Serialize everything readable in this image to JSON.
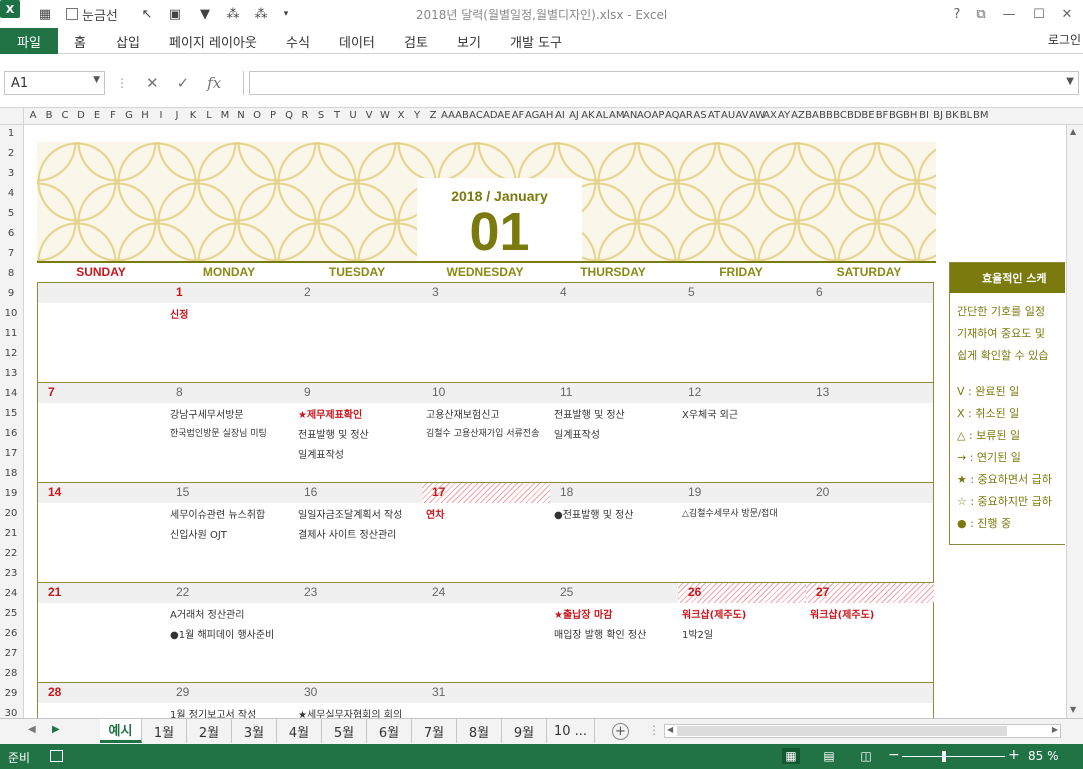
{
  "window": {
    "title": "2018년 달력(월별일정,월별디자인).xlsx - Excel",
    "gridlines_label": "눈금선",
    "help": "?",
    "signin": "로그인"
  },
  "ribbon": {
    "file_label": "파일",
    "tabs": [
      "홈",
      "삽입",
      "페이지 레이아웃",
      "수식",
      "데이터",
      "검토",
      "보기",
      "개발 도구"
    ]
  },
  "formula_bar": {
    "name_box": "A1",
    "fx_label": "fx",
    "formula_value": ""
  },
  "columns": [
    "A",
    "B",
    "C",
    "D",
    "E",
    "F",
    "G",
    "H",
    "I",
    "J",
    "K",
    "L",
    "M",
    "N",
    "O",
    "P",
    "Q",
    "R",
    "S",
    "T",
    "U",
    "V",
    "W",
    "X",
    "Y",
    "Z",
    "AA",
    "AB",
    "AC",
    "AD",
    "AE",
    "AF",
    "AG",
    "AH",
    "AI",
    "AJ",
    "AK",
    "AL",
    "AM",
    "AN",
    "AO",
    "AP",
    "AQ",
    "AR",
    "AS",
    "AT",
    "AU",
    "AV",
    "AW",
    "AX",
    "AY",
    "AZ",
    "BA",
    "BB",
    "BC",
    "BD",
    "BE",
    "BF",
    "BG",
    "BH",
    "BI",
    "BJ",
    "BK",
    "BL",
    "BM"
  ],
  "rows": [
    "1",
    "2",
    "3",
    "4",
    "5",
    "6",
    "7",
    "8",
    "9",
    "10",
    "11",
    "12",
    "13",
    "14",
    "15",
    "16",
    "17",
    "18",
    "19",
    "20",
    "21",
    "22",
    "23",
    "24",
    "25",
    "26",
    "27",
    "28",
    "29",
    "30"
  ],
  "calendar": {
    "year_month": "2018 / January",
    "month_number": "01",
    "accent_color": "#7a7a0e",
    "holiday_color": "#c8161d",
    "weekdays": [
      "SUNDAY",
      "MONDAY",
      "TUESDAY",
      "WEDNESDAY",
      "THURSDAY",
      "FRIDAY",
      "SATURDAY"
    ],
    "weeks": [
      [
        {
          "num": "",
          "events": []
        },
        {
          "num": "1",
          "red": true,
          "events": [
            {
              "text": "신정",
              "red": true
            }
          ]
        },
        {
          "num": "2",
          "events": []
        },
        {
          "num": "3",
          "events": []
        },
        {
          "num": "4",
          "events": []
        },
        {
          "num": "5",
          "events": []
        },
        {
          "num": "6",
          "events": []
        }
      ],
      [
        {
          "num": "7",
          "red": true,
          "events": []
        },
        {
          "num": "8",
          "events": [
            {
              "text": "강남구세무서방문"
            },
            {
              "text": "한국법인방문 실장님 미팅",
              "small": true
            }
          ]
        },
        {
          "num": "9",
          "events": [
            {
              "text": "★제무제표확인",
              "red": true
            },
            {
              "text": "전표발행 및 정산"
            },
            {
              "text": "일계표작성"
            }
          ]
        },
        {
          "num": "10",
          "events": [
            {
              "text": "고용산재보험신고"
            },
            {
              "text": "김철수 고용산재가입 서류전송",
              "small": true
            }
          ]
        },
        {
          "num": "11",
          "events": [
            {
              "text": "전표발행 및 정산"
            },
            {
              "text": "일계표작성"
            }
          ]
        },
        {
          "num": "12",
          "events": [
            {
              "text": "X우체국 외근"
            }
          ]
        },
        {
          "num": "13",
          "events": []
        }
      ],
      [
        {
          "num": "14",
          "red": true,
          "events": []
        },
        {
          "num": "15",
          "events": [
            {
              "text": "세무이슈관련 뉴스취합"
            },
            {
              "text": "신입사원 OJT"
            }
          ]
        },
        {
          "num": "16",
          "events": [
            {
              "text": "일일자금조달계획서 작성"
            },
            {
              "text": "결제사 사이트 정산관리"
            }
          ]
        },
        {
          "num": "17",
          "red": true,
          "hatch": true,
          "events": [
            {
              "text": "연차",
              "red": true
            }
          ]
        },
        {
          "num": "18",
          "events": [
            {
              "text": "●전표발행 및 정산"
            }
          ]
        },
        {
          "num": "19",
          "events": [
            {
              "text": "△김철수세무사 방문/접대",
              "small": true
            }
          ]
        },
        {
          "num": "20",
          "events": []
        }
      ],
      [
        {
          "num": "21",
          "red": true,
          "events": []
        },
        {
          "num": "22",
          "events": [
            {
              "text": "A거래처 정산관리"
            },
            {
              "text": "●1월 해피데이 행사준비"
            }
          ]
        },
        {
          "num": "23",
          "events": []
        },
        {
          "num": "24",
          "events": []
        },
        {
          "num": "25",
          "events": [
            {
              "text": "★출납장 마감",
              "red": true
            },
            {
              "text": "매입장 발행 확인 정산"
            }
          ]
        },
        {
          "num": "26",
          "red": true,
          "hatch": true,
          "events": [
            {
              "text": "워크샵(제주도)",
              "red": true
            },
            {
              "text": "1박2일"
            }
          ]
        },
        {
          "num": "27",
          "red": true,
          "hatch": true,
          "events": [
            {
              "text": "워크샵(제주도)",
              "red": true
            }
          ]
        }
      ],
      [
        {
          "num": "28",
          "red": true,
          "events": []
        },
        {
          "num": "29",
          "events": [
            {
              "text": "1월 정기보고서 작성"
            }
          ]
        },
        {
          "num": "30",
          "events": [
            {
              "text": "★세무실무자협회의 회의"
            }
          ]
        },
        {
          "num": "31",
          "events": []
        },
        {
          "num": "",
          "events": []
        },
        {
          "num": "",
          "events": []
        },
        {
          "num": "",
          "events": []
        }
      ]
    ]
  },
  "side_panel": {
    "title": "효율적인 스케",
    "desc": [
      "간단한 기호를 일정",
      "기재하여 중요도 및",
      "쉽게 확인할 수 있습"
    ],
    "legend": [
      "V : 완료된 일",
      "X : 취소된 일",
      "△ : 보류된 일",
      "→ : 연기된 일",
      "★ : 중요하면서 급하",
      "☆ : 중요하지만 급하",
      "● : 진행 중"
    ]
  },
  "sheet_tabs": {
    "tabs": [
      "예시",
      "1월",
      "2월",
      "3월",
      "4월",
      "5월",
      "6월",
      "7월",
      "8월",
      "9월",
      "10 ..."
    ],
    "active": "예시"
  },
  "status": {
    "ready": "준비",
    "zoom": "85 %"
  }
}
